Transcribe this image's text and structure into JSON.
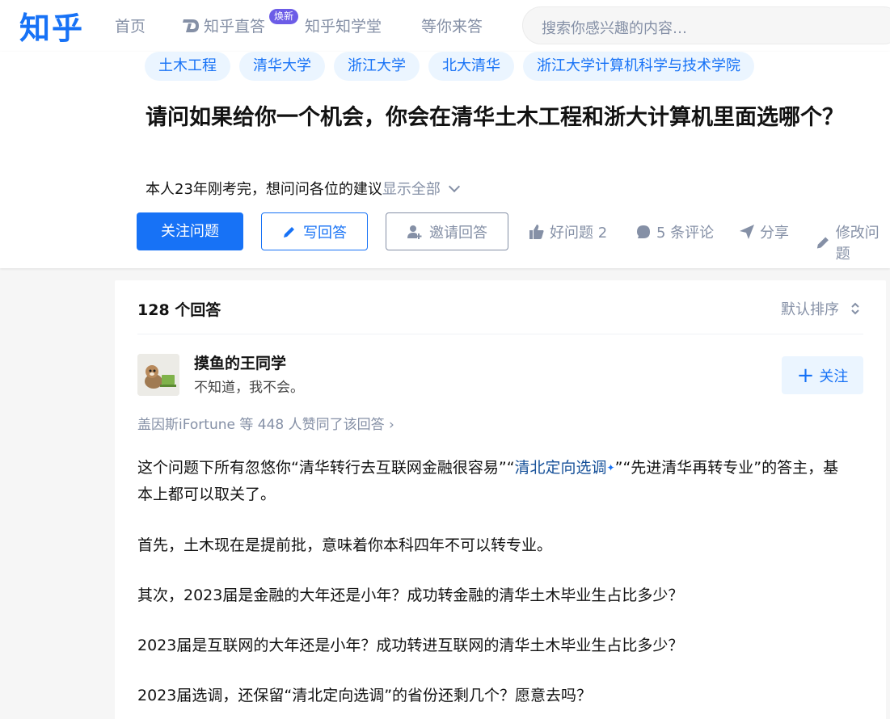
{
  "nav": {
    "logo": "知乎",
    "home": "首页",
    "zhida": "知乎直答",
    "zhida_badge": "焕新",
    "zhixuetang": "知乎知学堂",
    "waiting": "等你来答",
    "search_placeholder": "搜索你感兴趣的内容…"
  },
  "tags": [
    "土木工程",
    "清华大学",
    "浙江大学",
    "北大清华",
    "浙江大学计算机科学与技术学院"
  ],
  "question": {
    "title": "请问如果给你一个机会，你会在清华土木工程和浙大计算机里面选哪个？",
    "detail": "本人23年刚考完，想问问各位的建议",
    "show_all": "显示全部"
  },
  "actions": {
    "follow": "关注问题",
    "write": "写回答",
    "invite": "邀请回答",
    "good_question": "好问题 2",
    "comments": "5 条评论",
    "share": "分享",
    "edit": "修改问题"
  },
  "answers": {
    "count": "128 个回答",
    "sort": "默认排序"
  },
  "answer": {
    "author": "摸鱼的王同学",
    "bio": "不知道，我不会。",
    "follow": "关注",
    "voters": "盖因斯iFortune 等 448 人赞同了该回答 ›",
    "p1_a": "这个问题下所有忽悠你“清华转行去互联网金融很容易”“",
    "p1_link": "清北定向选调",
    "p1_b": "”“先进清华再转专业”的答主，基本上都可以取关了。",
    "p2": "首先，土木现在是提前批，意味着你本科四年不可以转专业。",
    "p3": "其次，2023届是金融的大年还是小年？成功转金融的清华土木毕业生占比多少？",
    "p4": "2023届是互联网的大年还是小年？成功转进互联网的清华土木毕业生占比多少？",
    "p5": "2023届选调，还保留“清北定向选调”的省份还剩几个？愿意去吗？"
  },
  "colors": {
    "brand": "#1772f6",
    "tag_bg": "#ebf5ff",
    "muted": "#8590a6",
    "badge": "#6c5ce7"
  }
}
